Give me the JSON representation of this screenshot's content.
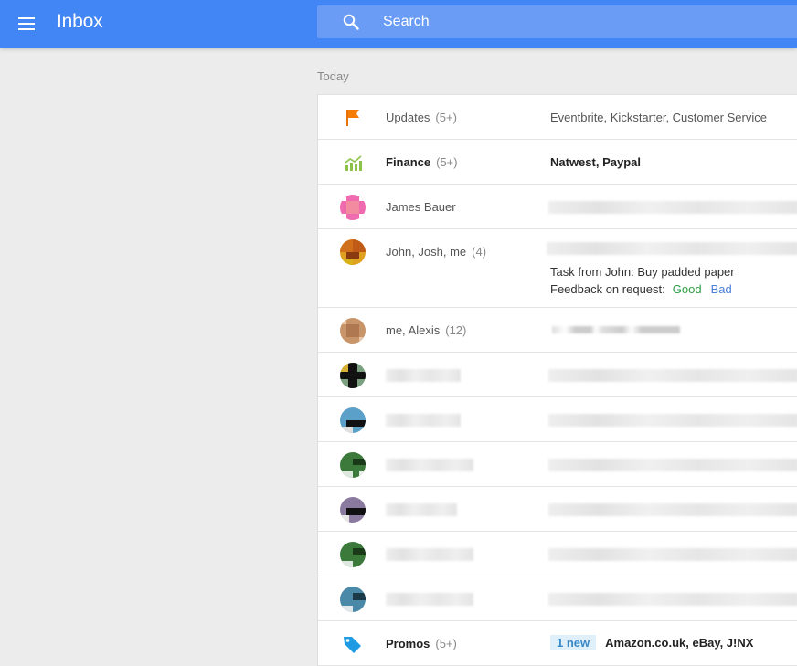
{
  "header": {
    "title": "Inbox",
    "search_placeholder": "Search",
    "colors": {
      "bar": "#4285f4",
      "search_bg": "#6a9cf6"
    }
  },
  "section": {
    "label": "Today"
  },
  "rows": {
    "updates": {
      "icon": "flag-icon",
      "sender": "Updates",
      "count": "(5+)",
      "snippet": "Eventbrite, Kickstarter, Customer Service"
    },
    "finance": {
      "icon": "chart-icon",
      "sender": "Finance",
      "count": "(5+)",
      "snippet": "Natwest, Paypal"
    },
    "james": {
      "sender": "James Bauer"
    },
    "john": {
      "sender": "John, Josh, me",
      "count": "(4)",
      "task": "Task from John: Buy padded paper",
      "feedback_label": "Feedback on request:",
      "good": "Good",
      "bad": "Bad"
    },
    "alexis": {
      "sender": "me, Alexis",
      "count": "(12)"
    },
    "promos": {
      "icon": "tag-icon",
      "sender": "Promos",
      "count": "(5+)",
      "badge": "1 new",
      "snippet": "Amazon.co.uk, eBay, J!NX"
    }
  }
}
